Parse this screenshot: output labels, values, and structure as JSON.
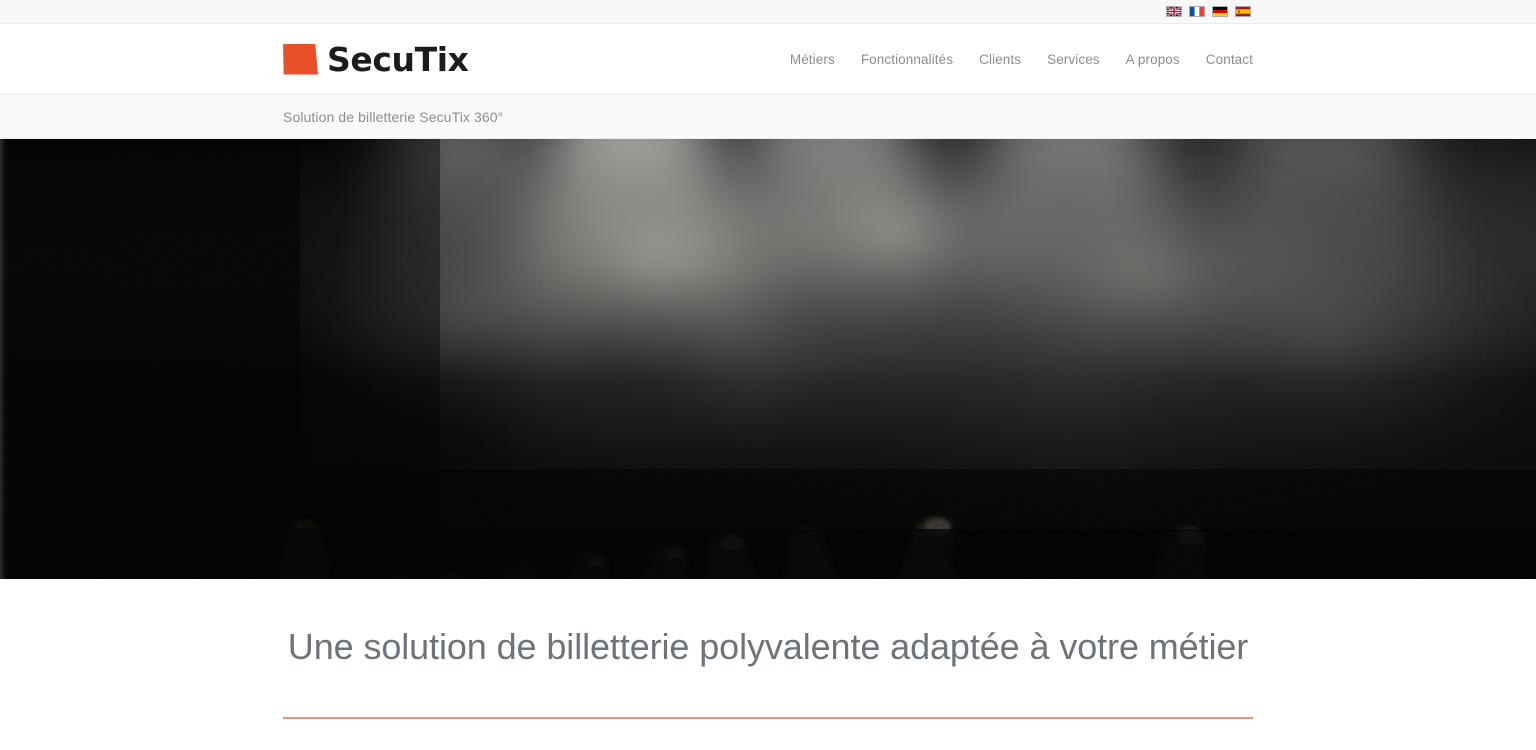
{
  "topbar": {
    "languages": [
      {
        "name": "english-flag",
        "label": "English",
        "code": "en"
      },
      {
        "name": "french-flag",
        "label": "Français",
        "code": "fr"
      },
      {
        "name": "german-flag",
        "label": "Deutsch",
        "code": "de"
      },
      {
        "name": "spanish-flag",
        "label": "Español",
        "code": "es"
      }
    ]
  },
  "header": {
    "logo_text": "SecuTix",
    "logo_mark": "orange-quadrilateral",
    "nav": [
      {
        "label": "Métiers"
      },
      {
        "label": "Fonctionnalités"
      },
      {
        "label": "Clients"
      },
      {
        "label": "Services"
      },
      {
        "label": "A propos"
      },
      {
        "label": "Contact"
      }
    ]
  },
  "breadcrumb": {
    "text": "Solution de billetterie SecuTix 360°"
  },
  "hero": {
    "alt": "Danseuses de ballet en silhouette sur scène sombre avec fumée et projecteurs"
  },
  "main": {
    "section_title": "Une solution de billetterie polyvalente adaptée à votre métier"
  },
  "colors": {
    "brand_orange": "#e8502a",
    "divider_salmon": "#f09077",
    "nav_gray": "#8d8d8d",
    "title_gray": "#6d737a",
    "topbar_bg": "#f7f7f7",
    "crumbbar_bg": "#fafafa"
  }
}
